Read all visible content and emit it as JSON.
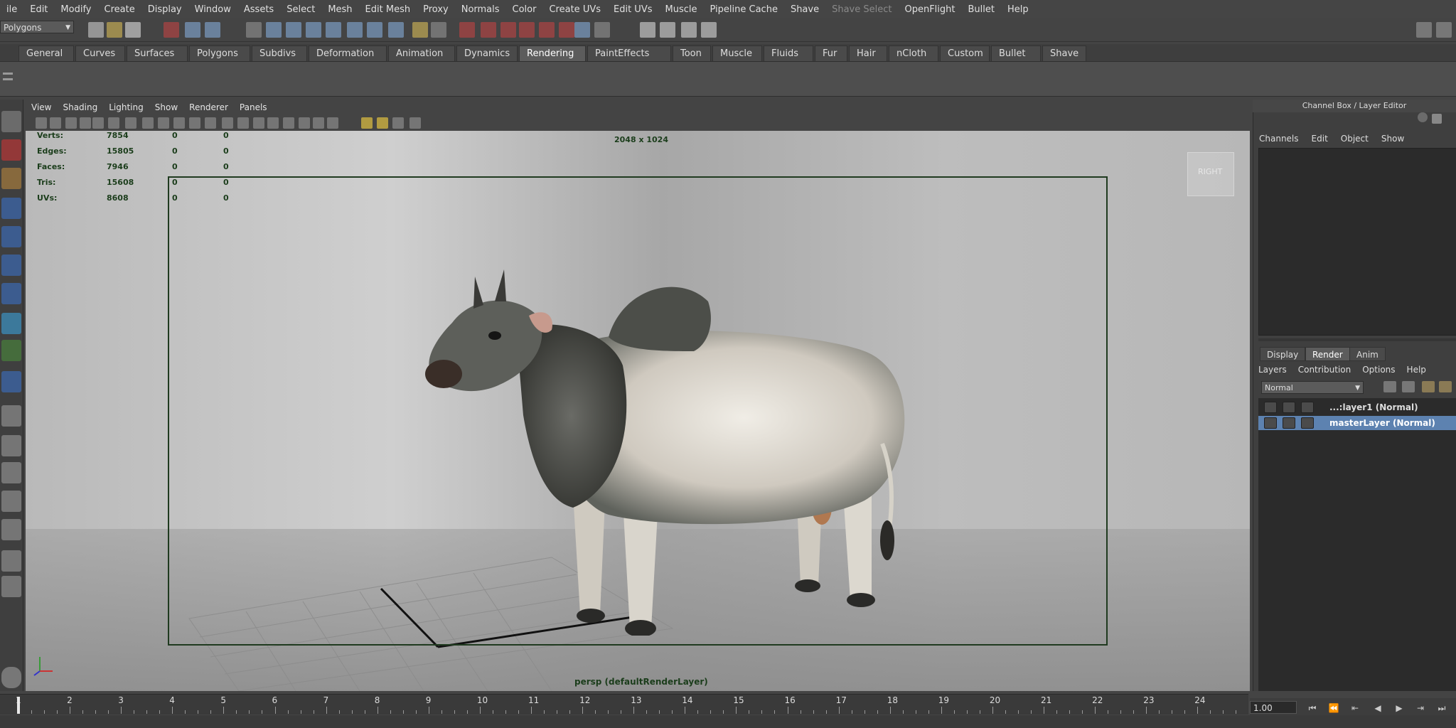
{
  "menubar": {
    "items": [
      "ile",
      "Edit",
      "Modify",
      "Create",
      "Display",
      "Window",
      "Assets",
      "Select",
      "Mesh",
      "Edit Mesh",
      "Proxy",
      "Normals",
      "Color",
      "Create UVs",
      "Edit UVs",
      "Muscle",
      "Pipeline Cache",
      "Shave"
    ],
    "disabled_item": "Shave Select",
    "items_after": [
      "OpenFlight",
      "Bullet",
      "Help"
    ]
  },
  "status": {
    "mode": "Polygons"
  },
  "shelf": {
    "tabs": [
      "General",
      "Curves",
      "Surfaces",
      "Polygons",
      "Subdivs",
      "Deformation",
      "Animation",
      "Dynamics",
      "Rendering",
      "PaintEffects",
      "Toon",
      "Muscle",
      "Fluids",
      "Fur",
      "Hair",
      "nCloth",
      "Custom",
      "Bullet",
      "Shave"
    ],
    "active": "Rendering"
  },
  "panel": {
    "menu": [
      "View",
      "Shading",
      "Lighting",
      "Show",
      "Renderer",
      "Panels"
    ]
  },
  "hud": {
    "rows": [
      {
        "label": "Verts:",
        "a": "7854",
        "b": "0",
        "c": "0"
      },
      {
        "label": "Edges:",
        "a": "15805",
        "b": "0",
        "c": "0"
      },
      {
        "label": "Faces:",
        "a": "7946",
        "b": "0",
        "c": "0"
      },
      {
        "label": "Tris:",
        "a": "15608",
        "b": "0",
        "c": "0"
      },
      {
        "label": "UVs:",
        "a": "8608",
        "b": "0",
        "c": "0"
      }
    ],
    "resolution": "2048 x 1024",
    "camera_label": "persp (defaultRenderLayer)",
    "viewcube": "RIGHT"
  },
  "channelbox": {
    "title": "Channel Box / Layer Editor",
    "menu": [
      "Channels",
      "Edit",
      "Object",
      "Show"
    ]
  },
  "layereditor": {
    "tabs": [
      "Display",
      "Render",
      "Anim"
    ],
    "active_tab": "Render",
    "menu": [
      "Layers",
      "Contribution",
      "Options",
      "Help"
    ],
    "blend_mode": "Normal",
    "layers": [
      {
        "name": "...:layer1 (Normal)",
        "selected": false
      },
      {
        "name": "masterLayer (Normal)",
        "selected": true
      }
    ]
  },
  "timeline": {
    "ticks": [
      "1",
      "2",
      "3",
      "4",
      "5",
      "6",
      "7",
      "8",
      "9",
      "10",
      "11",
      "12",
      "13",
      "14",
      "15",
      "16",
      "17",
      "18",
      "19",
      "20",
      "21",
      "22",
      "23",
      "24"
    ],
    "current_time": "1.00"
  }
}
